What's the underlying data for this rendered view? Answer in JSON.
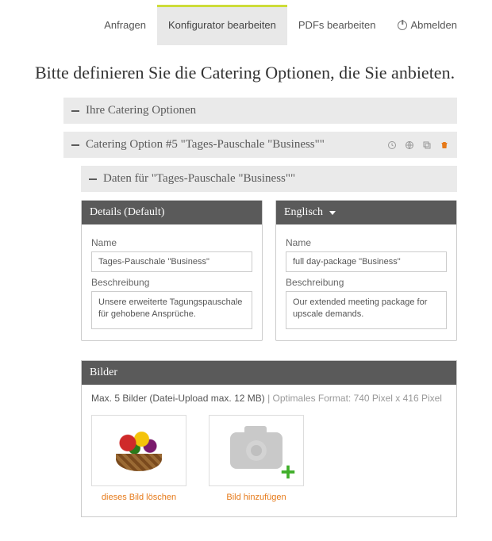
{
  "nav": {
    "items": [
      {
        "label": "Anfragen",
        "active": false
      },
      {
        "label": "Konfigurator bearbeiten",
        "active": true
      },
      {
        "label": "PDFs bearbeiten",
        "active": false
      },
      {
        "label": "Abmelden",
        "active": false
      }
    ]
  },
  "page_title": "Bitte definieren Sie die Catering Optionen, die Sie anbieten.",
  "accordion": {
    "level0_label": "Ihre Catering Optionen",
    "level1_label": "Catering Option #5 \"Tages-Pauschale \"Business\"\"",
    "level2_label": "Daten für \"Tages-Pauschale \"Business\"\"",
    "toolbar_icon_names": [
      "clock-icon",
      "globe-icon",
      "duplicate-icon",
      "trash-icon"
    ]
  },
  "details": {
    "header": "Details (Default)",
    "name_label": "Name",
    "name_value": "Tages-Pauschale \"Business\"",
    "desc_label": "Beschreibung",
    "desc_value": "Unsere erweiterte Tagungspauschale für gehobene Ansprüche."
  },
  "english": {
    "header": "Englisch",
    "name_label": "Name",
    "name_value": "full day-package \"Business\"",
    "desc_label": "Beschreibung",
    "desc_value": "Our extended meeting package for upscale demands."
  },
  "images": {
    "header": "Bilder",
    "hint_main": "Max. 5 Bilder (Datei-Upload max. 12 MB)",
    "hint_sub": "Optimales Format: 740 Pixel x 416 Pixel",
    "thumbs": [
      {
        "caption": "dieses Bild löschen"
      },
      {
        "caption": "Bild hinzufügen"
      }
    ]
  }
}
